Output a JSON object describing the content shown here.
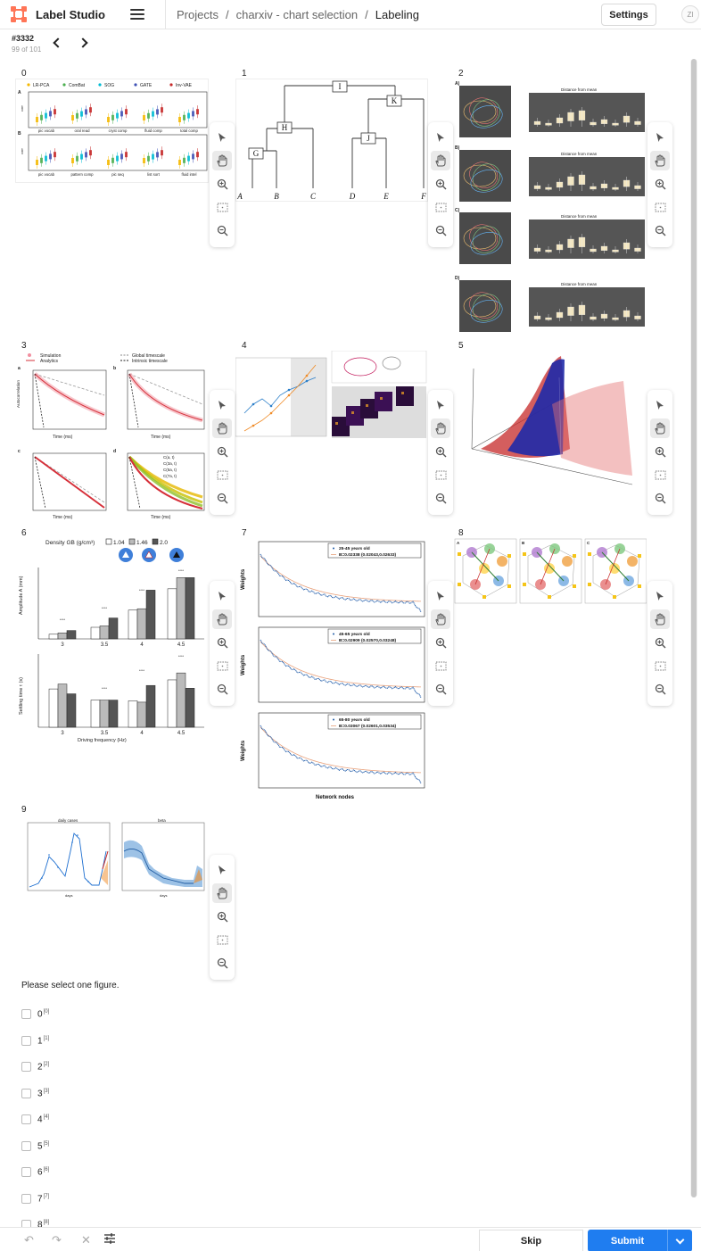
{
  "header": {
    "app_name": "Label Studio",
    "breadcrumbs": [
      "Projects",
      "/",
      "charxiv - chart selection",
      "/",
      "Labeling"
    ],
    "settings_label": "Settings",
    "avatar_initials": "ZI",
    "brand_color": "#ff7557"
  },
  "task": {
    "id": "#3332",
    "position": "99 of 101"
  },
  "figures": [
    {
      "label": "0"
    },
    {
      "label": "1"
    },
    {
      "label": "2"
    },
    {
      "label": "3"
    },
    {
      "label": "4"
    },
    {
      "label": "5"
    },
    {
      "label": "6"
    },
    {
      "label": "7"
    },
    {
      "label": "8"
    },
    {
      "label": "9"
    }
  ],
  "figure_text": {
    "f0": {
      "legend": [
        "LR-PCA",
        "ComBat",
        "SOG",
        "GATE",
        "Inv-VAE"
      ],
      "panels": [
        "A",
        "B"
      ],
      "ylabel": "corr",
      "top_ticks": [
        "pic vocab",
        "oral read",
        "cryst comp",
        "fluid comp",
        "total comp"
      ],
      "bottom_ticks": [
        "pic vocab",
        "pattern comp",
        "pic seq",
        "list sort",
        "fluid intel"
      ]
    },
    "f1": {
      "nodes": [
        "I",
        "H",
        "K",
        "G",
        "J"
      ],
      "leaves": [
        "A",
        "B",
        "C",
        "D",
        "E",
        "F"
      ]
    },
    "f2": {
      "rows": [
        "A)",
        "B)",
        "C)",
        "D)"
      ],
      "box_title": "Distance from mean"
    },
    "f3": {
      "legend": [
        "Simulation",
        "Analytics",
        "Global timescale",
        "Intrinsic timescale"
      ],
      "panels": [
        "a",
        "b",
        "c",
        "d"
      ],
      "ylabel": "Autocorrelation",
      "xlabel": "Time (ms)",
      "d_legend": [
        "C(a, t)",
        "C(3a, t)",
        "C(5a, t)",
        "C(7a, t)"
      ]
    },
    "f6": {
      "title": "Density GB  (g/cm³)",
      "densities": [
        "1.04",
        "1.46",
        "2.0"
      ],
      "ylabel_top": "Amplitude A (mm)",
      "ylabel_bottom": "Settling time τ (s)",
      "xlabel": "Driving frequency (Hz)",
      "x_ticks": [
        "3",
        "3.5",
        "4",
        "4.5"
      ],
      "sig": "****"
    },
    "f7": {
      "ylabel": "Weights",
      "xlabel": "Network nodes",
      "panels": [
        {
          "legend_a": "25-45 years old",
          "legend_b": "B=0.02338 (0.02043,0.02633)"
        },
        {
          "legend_a": "45-65 years old",
          "legend_b": "B=0.02909 (0.02570,0.03248)"
        },
        {
          "legend_a": "65-80 years old",
          "legend_b": "B=0.03067 (0.02601,0.03534)"
        }
      ]
    },
    "f8": {
      "panels": [
        "A",
        "B",
        "C"
      ]
    },
    "f9": {
      "titles": [
        "daily cases",
        "beta"
      ],
      "xlabel": "days"
    }
  },
  "question": {
    "prompt": "Please select one figure.",
    "options": [
      {
        "label": "0",
        "hotkey": "[0]"
      },
      {
        "label": "1",
        "hotkey": "[1]"
      },
      {
        "label": "2",
        "hotkey": "[2]"
      },
      {
        "label": "3",
        "hotkey": "[3]"
      },
      {
        "label": "4",
        "hotkey": "[4]"
      },
      {
        "label": "5",
        "hotkey": "[5]"
      },
      {
        "label": "6",
        "hotkey": "[6]"
      },
      {
        "label": "7",
        "hotkey": "[7]"
      },
      {
        "label": "8",
        "hotkey": "[8]"
      }
    ]
  },
  "footer": {
    "skip_label": "Skip",
    "submit_label": "Submit",
    "submit_color": "#1f7df0"
  }
}
